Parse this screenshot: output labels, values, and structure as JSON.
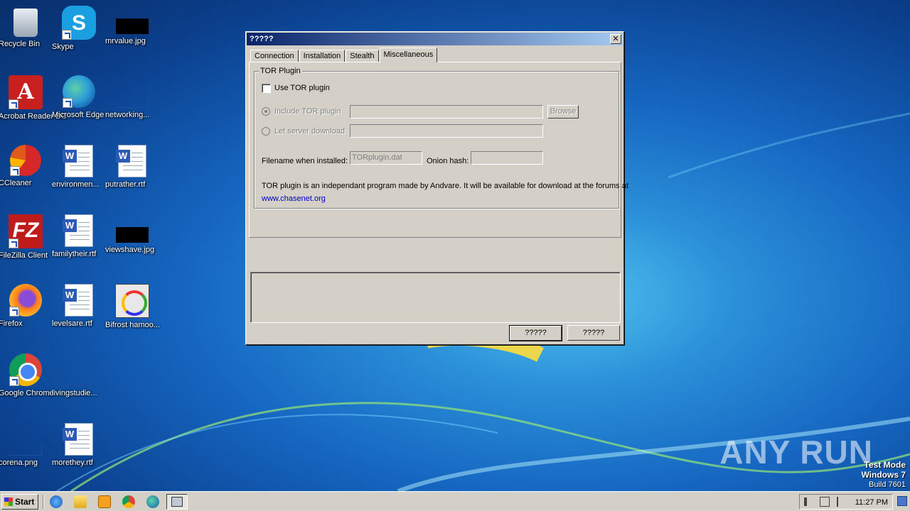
{
  "desktop": {
    "icons": [
      {
        "label": "Recycle Bin"
      },
      {
        "label": "Skype"
      },
      {
        "label": "mrvalue.jpg"
      },
      {
        "label": "Acrobat Reader DC"
      },
      {
        "label": "Microsoft Edge"
      },
      {
        "label": "networking..."
      },
      {
        "label": "CCleaner"
      },
      {
        "label": "environmen..."
      },
      {
        "label": "putrather.rtf"
      },
      {
        "label": "FileZilla Client"
      },
      {
        "label": "familytheir.rtf"
      },
      {
        "label": "viewshave.jpg"
      },
      {
        "label": "Firefox"
      },
      {
        "label": "levelsare.rtf"
      },
      {
        "label": "Bifrost hamoo..."
      },
      {
        "label": "Google Chrome"
      },
      {
        "label": "livingstudie..."
      },
      {
        "label": "corena.png"
      },
      {
        "label": "morethey.rtf"
      }
    ]
  },
  "dialog": {
    "title": "?????",
    "close_glyph": "✕",
    "tabs": [
      {
        "label": "Connection"
      },
      {
        "label": "Installation"
      },
      {
        "label": "Stealth"
      },
      {
        "label": "Miscellaneous"
      }
    ],
    "active_tab": "Miscellaneous",
    "group_title": "TOR Plugin",
    "use_tor_label": "Use TOR plugin",
    "use_tor_checked": false,
    "include_label": "Include TOR plugin",
    "include_value": "",
    "browse_label": "Browse",
    "let_server_label": "Let server download",
    "let_server_value": "",
    "filename_label": "Filename when installed:",
    "filename_value": "TORplugin.dat",
    "onion_label": "Onion hash:",
    "onion_value": "",
    "info_text": "TOR plugin is an independant program made by Andvare. It will be available for download at the forums at",
    "info_link": "www.chasenet.org",
    "log_text": "",
    "ok_label": "?????",
    "cancel_label": "?????"
  },
  "taskbar": {
    "start_label": "Start",
    "clock": "11:27 PM"
  },
  "watermark": {
    "brand": "ANY RUN",
    "line1": "Test Mode",
    "line2": "Windows 7",
    "line3": "Build 7601"
  }
}
